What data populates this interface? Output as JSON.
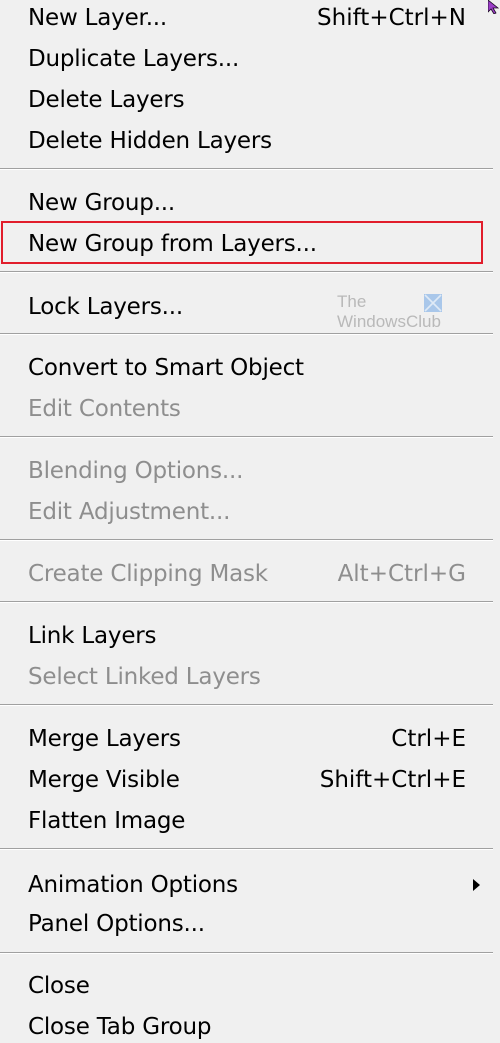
{
  "menu": {
    "items": [
      {
        "label": "New Layer...",
        "shortcut": "Shift+Ctrl+N"
      },
      {
        "label": "Duplicate Layers...",
        "shortcut": ""
      },
      {
        "label": "Delete Layers",
        "shortcut": ""
      },
      {
        "label": "Delete Hidden Layers",
        "shortcut": ""
      },
      {
        "label": "New Group...",
        "shortcut": ""
      },
      {
        "label": "New Group from Layers...",
        "shortcut": ""
      },
      {
        "label": "Lock Layers...",
        "shortcut": ""
      },
      {
        "label": "Convert to Smart Object",
        "shortcut": ""
      },
      {
        "label": "Edit Contents",
        "shortcut": ""
      },
      {
        "label": "Blending Options...",
        "shortcut": ""
      },
      {
        "label": "Edit Adjustment...",
        "shortcut": ""
      },
      {
        "label": "Create Clipping Mask",
        "shortcut": "Alt+Ctrl+G"
      },
      {
        "label": "Link Layers",
        "shortcut": ""
      },
      {
        "label": "Select Linked Layers",
        "shortcut": ""
      },
      {
        "label": "Merge Layers",
        "shortcut": "Ctrl+E"
      },
      {
        "label": "Merge Visible",
        "shortcut": "Shift+Ctrl+E"
      },
      {
        "label": "Flatten Image",
        "shortcut": ""
      },
      {
        "label": "Animation Options",
        "shortcut": ""
      },
      {
        "label": "Panel Options...",
        "shortcut": ""
      },
      {
        "label": "Close",
        "shortcut": ""
      },
      {
        "label": "Close Tab Group",
        "shortcut": ""
      }
    ]
  },
  "watermark": {
    "line1": "The",
    "line2": "WindowsClub"
  },
  "colors": {
    "highlight_border": "#e11d2b",
    "disabled_text": "#8e8e8e",
    "menu_background": "#f0f0f0"
  }
}
